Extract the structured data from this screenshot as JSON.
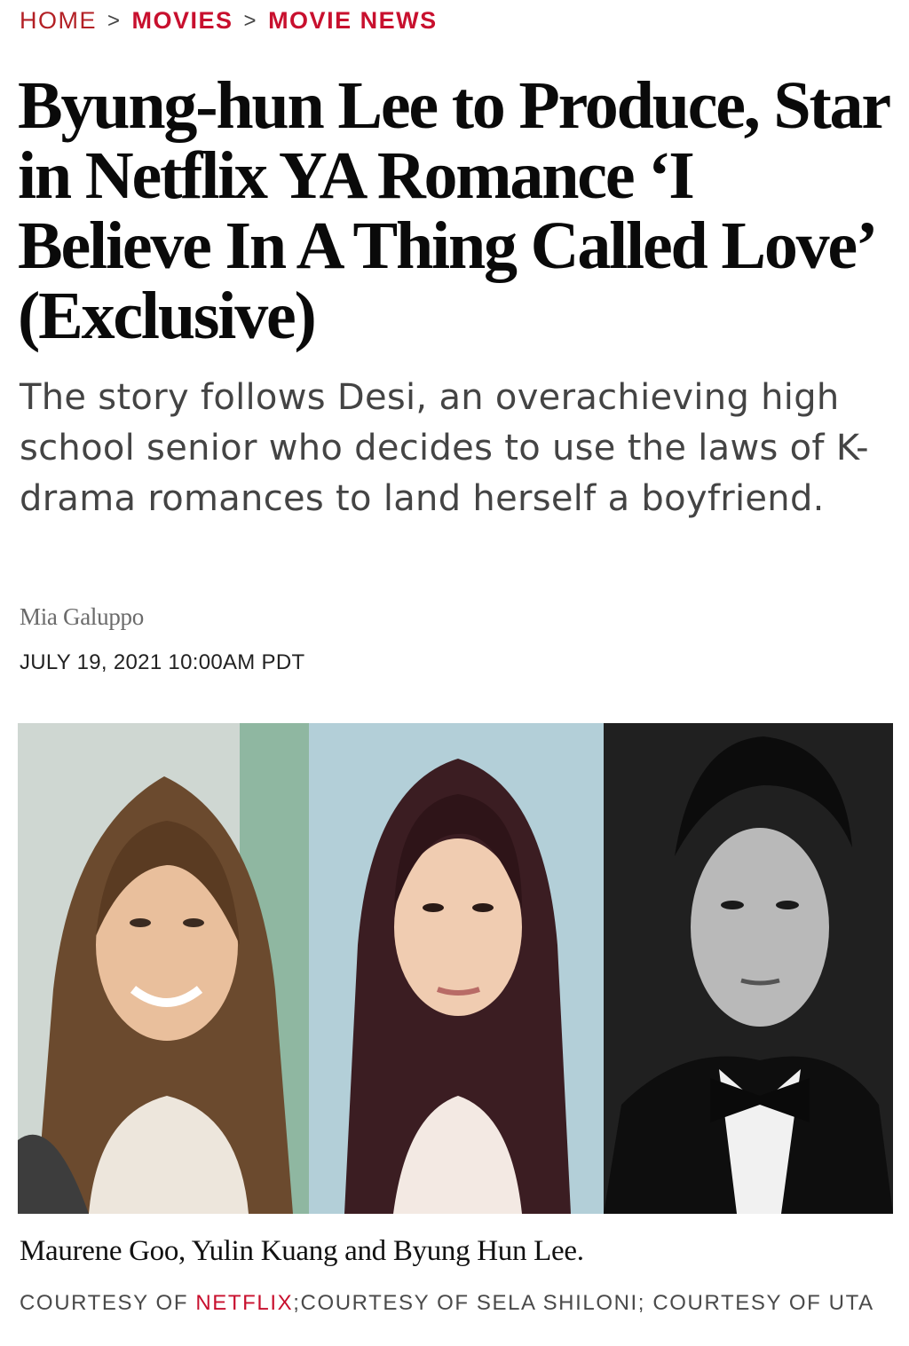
{
  "breadcrumb": {
    "home": "HOME",
    "sep1": ">",
    "movies": "MOVIES",
    "sep2": ">",
    "movie_news": "MOVIE NEWS"
  },
  "article": {
    "headline": "Byung-hun Lee to Produce, Star in Netflix YA Romance ‘I Believe In A Thing Called Love’ (Exclusive)",
    "dek": "The story follows Desi, an overachieving high school senior who decides to use the laws of K-drama romances to land herself a boyfriend.",
    "author": "Mia Galuppo",
    "date": "JULY 19, 2021 10:00AM PDT"
  },
  "photo": {
    "caption": "Maurene Goo, Yulin Kuang and Byung Hun Lee.",
    "credit_prefix": "COURTESY OF ",
    "credit_link": "NETFLIX",
    "credit_rest": ";COURTESY OF SELA SHILONI; COURTESY OF UTA"
  },
  "colors": {
    "accent": "#c8102e",
    "headline": "#0a0a0a",
    "dek": "#444444"
  }
}
